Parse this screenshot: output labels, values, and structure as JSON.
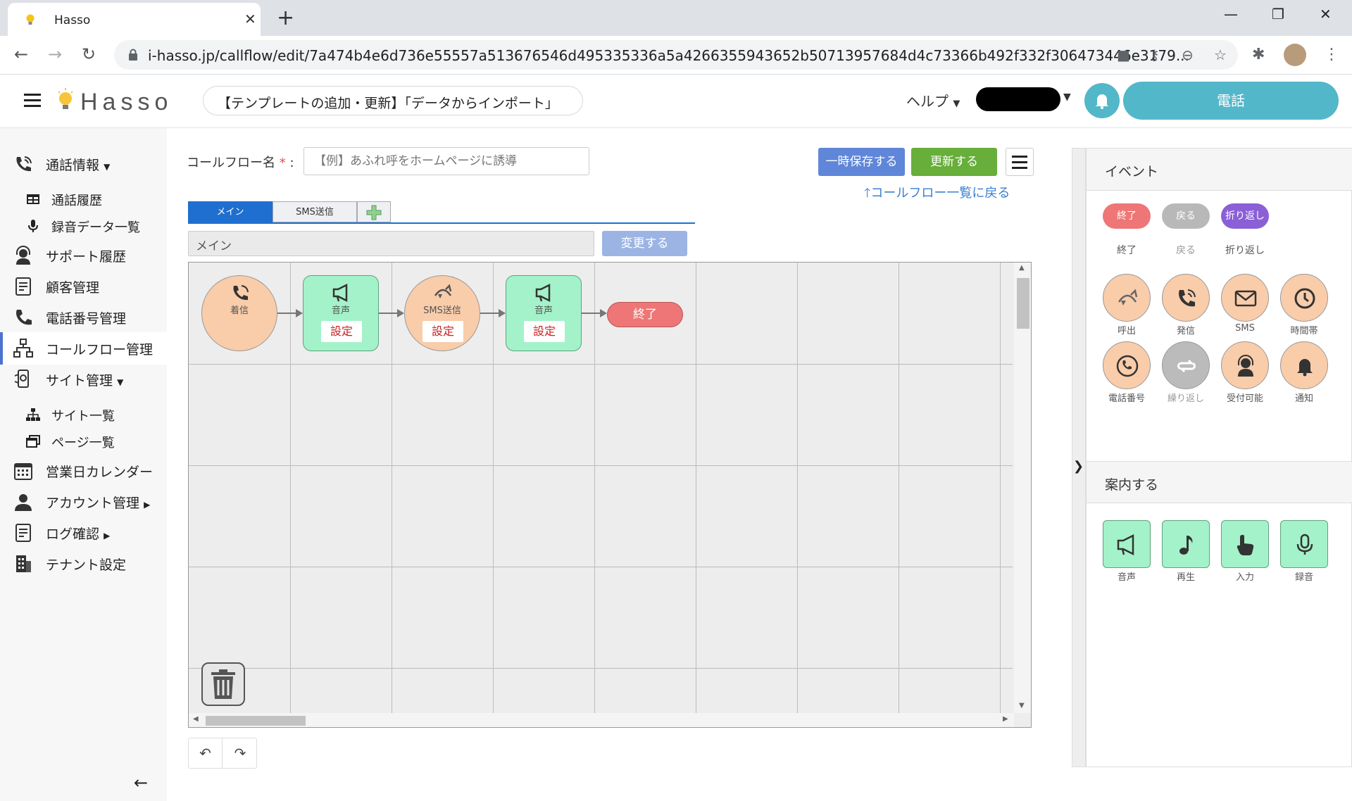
{
  "browser": {
    "tab_title": "Hasso",
    "url": "i-hasso.jp/callflow/edit/7a474b4e6d736e55557a513676546d495335336a5a4266355943652b50713957684d4c73366b492f332f306473446e3179..."
  },
  "header": {
    "logo_text": "Hasso",
    "template_notice": "【テンプレートの追加・更新】「データからインポート」",
    "help_label": "ヘルプ",
    "phone_button_label": "電話"
  },
  "sidebar": {
    "items": [
      {
        "label": "通話情報"
      },
      {
        "label": "通話履歴"
      },
      {
        "label": "録音データ一覧"
      },
      {
        "label": "サポート履歴"
      },
      {
        "label": "顧客管理"
      },
      {
        "label": "電話番号管理"
      },
      {
        "label": "コールフロー管理"
      },
      {
        "label": "サイト管理"
      },
      {
        "label": "サイト一覧"
      },
      {
        "label": "ページ一覧"
      },
      {
        "label": "営業日カレンダー"
      },
      {
        "label": "アカウント管理"
      },
      {
        "label": "ログ確認"
      },
      {
        "label": "テナント設定"
      }
    ]
  },
  "main": {
    "flow_name_label": "コールフロー名",
    "flow_name_required": "*",
    "flow_name_colon": ":",
    "flow_name_placeholder": "【例】あふれ呼をホームページに誘導",
    "save_temp_label": "一時保存する",
    "update_label": "更新する",
    "back_link_label": "コールフロー一覧に戻る",
    "tabs": [
      {
        "label": "メイン"
      },
      {
        "label": "SMS送信"
      }
    ],
    "tab_name_value": "メイン",
    "change_label": "変更する",
    "nodes": [
      {
        "label": "着信"
      },
      {
        "label": "音声",
        "action": "設定"
      },
      {
        "label": "SMS送信",
        "action": "設定"
      },
      {
        "label": "音声",
        "action": "設定"
      },
      {
        "label": "終了"
      }
    ]
  },
  "right_panel": {
    "event_title": "イベント",
    "pills": [
      {
        "label": "終了",
        "caption": "終了",
        "color": "#ee7676"
      },
      {
        "label": "戻る",
        "caption": "戻る",
        "color": "#b8b8b8"
      },
      {
        "label": "折り返し",
        "caption": "折り返し",
        "color": "#8b5fd6"
      }
    ],
    "events": [
      {
        "label": "呼出",
        "icon": "redirect-icon"
      },
      {
        "label": "発信",
        "icon": "phone-ring-icon"
      },
      {
        "label": "SMS",
        "icon": "mail-icon"
      },
      {
        "label": "時間帯",
        "icon": "clock-icon"
      },
      {
        "label": "電話番号",
        "icon": "phone-number-icon"
      },
      {
        "label": "繰り返し",
        "icon": "repeat-icon",
        "disabled": true
      },
      {
        "label": "受付可能",
        "icon": "operator-icon"
      },
      {
        "label": "通知",
        "icon": "bell-icon"
      }
    ],
    "guide_title": "案内する",
    "guides": [
      {
        "label": "音声",
        "icon": "speaker-icon"
      },
      {
        "label": "再生",
        "icon": "music-note-icon"
      },
      {
        "label": "入力",
        "icon": "hand-point-icon"
      },
      {
        "label": "録音",
        "icon": "microphone-icon"
      }
    ]
  }
}
